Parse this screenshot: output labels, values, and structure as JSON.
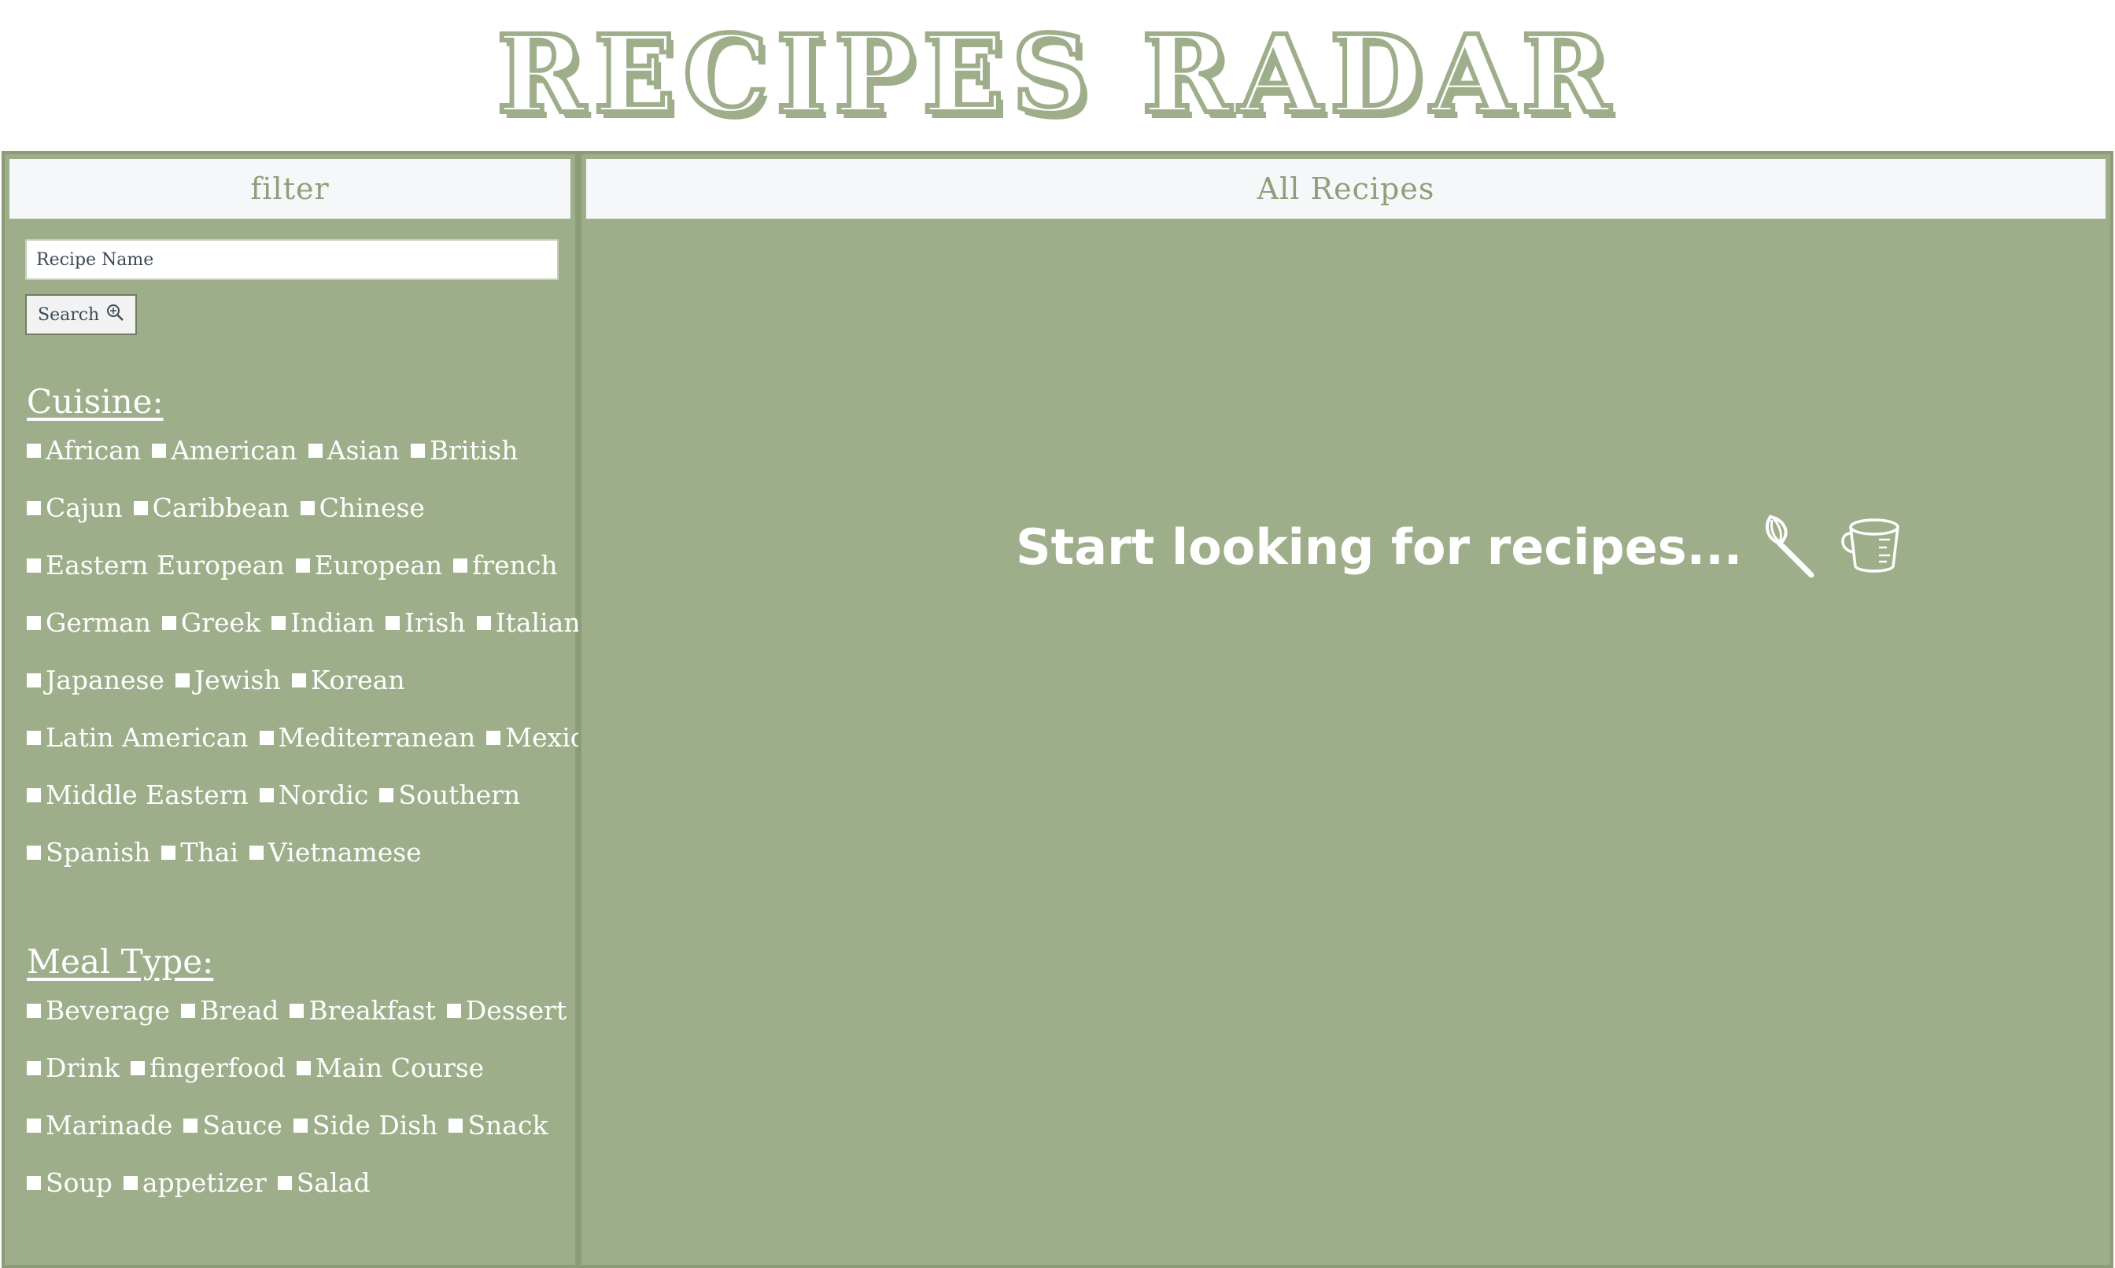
{
  "header": {
    "logo_text": "RECIPES RADAR"
  },
  "filter": {
    "title": "filter",
    "search_placeholder": "Recipe Name",
    "search_button": "Search",
    "cuisine": {
      "title": "Cuisine:",
      "rows": [
        [
          "African",
          "American",
          "Asian",
          "British"
        ],
        [
          "Cajun",
          "Caribbean",
          "Chinese"
        ],
        [
          "Eastern European",
          "European",
          "french"
        ],
        [
          "German",
          "Greek",
          "Indian",
          "Irish",
          "Italian"
        ],
        [
          "Japanese",
          "Jewish",
          "Korean"
        ],
        [
          "Latin American",
          "Mediterranean",
          "Mexican"
        ],
        [
          "Middle Eastern",
          "Nordic",
          "Southern"
        ],
        [
          "Spanish",
          "Thai",
          "Vietnamese"
        ]
      ]
    },
    "meal_type": {
      "title": "Meal Type:",
      "rows": [
        [
          "Beverage",
          "Bread",
          "Breakfast",
          "Dessert"
        ],
        [
          "Drink",
          "fingerfood",
          "Main Course"
        ],
        [
          "Marinade",
          "Sauce",
          "Side Dish",
          "Snack"
        ],
        [
          "Soup",
          "appetizer",
          "Salad"
        ]
      ]
    }
  },
  "recipes": {
    "title": "All Recipes",
    "empty_text": "Start looking for recipes..."
  },
  "icons": [
    "search-icon",
    "whisk-icon",
    "measuring-cup-icon"
  ],
  "colors": {
    "panel": "#9fae8a",
    "header_bar": "#f6f7f9",
    "text_on_panel": "#ffffff"
  }
}
